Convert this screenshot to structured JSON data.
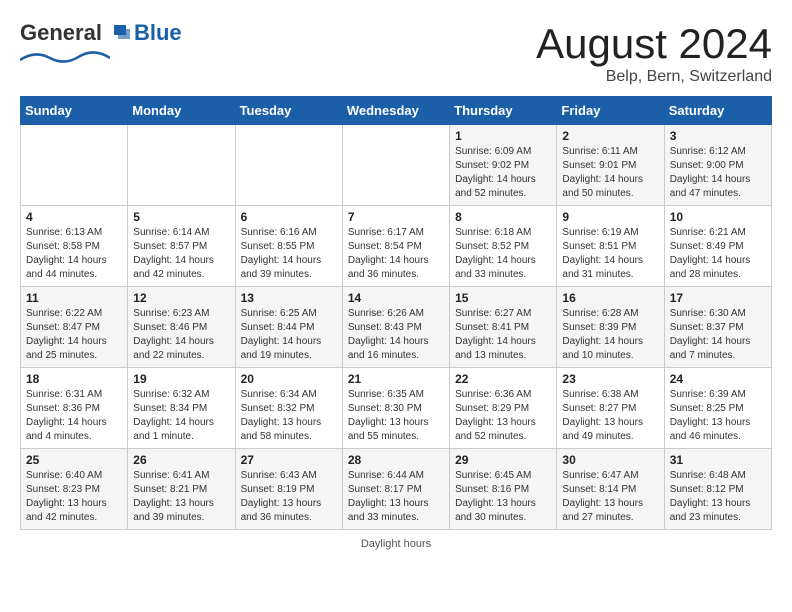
{
  "header": {
    "logo_general": "General",
    "logo_blue": "Blue",
    "month": "August 2024",
    "location": "Belp, Bern, Switzerland"
  },
  "days_of_week": [
    "Sunday",
    "Monday",
    "Tuesday",
    "Wednesday",
    "Thursday",
    "Friday",
    "Saturday"
  ],
  "weeks": [
    [
      {
        "day": "",
        "info": ""
      },
      {
        "day": "",
        "info": ""
      },
      {
        "day": "",
        "info": ""
      },
      {
        "day": "",
        "info": ""
      },
      {
        "day": "1",
        "info": "Sunrise: 6:09 AM\nSunset: 9:02 PM\nDaylight: 14 hours\nand 52 minutes."
      },
      {
        "day": "2",
        "info": "Sunrise: 6:11 AM\nSunset: 9:01 PM\nDaylight: 14 hours\nand 50 minutes."
      },
      {
        "day": "3",
        "info": "Sunrise: 6:12 AM\nSunset: 9:00 PM\nDaylight: 14 hours\nand 47 minutes."
      }
    ],
    [
      {
        "day": "4",
        "info": "Sunrise: 6:13 AM\nSunset: 8:58 PM\nDaylight: 14 hours\nand 44 minutes."
      },
      {
        "day": "5",
        "info": "Sunrise: 6:14 AM\nSunset: 8:57 PM\nDaylight: 14 hours\nand 42 minutes."
      },
      {
        "day": "6",
        "info": "Sunrise: 6:16 AM\nSunset: 8:55 PM\nDaylight: 14 hours\nand 39 minutes."
      },
      {
        "day": "7",
        "info": "Sunrise: 6:17 AM\nSunset: 8:54 PM\nDaylight: 14 hours\nand 36 minutes."
      },
      {
        "day": "8",
        "info": "Sunrise: 6:18 AM\nSunset: 8:52 PM\nDaylight: 14 hours\nand 33 minutes."
      },
      {
        "day": "9",
        "info": "Sunrise: 6:19 AM\nSunset: 8:51 PM\nDaylight: 14 hours\nand 31 minutes."
      },
      {
        "day": "10",
        "info": "Sunrise: 6:21 AM\nSunset: 8:49 PM\nDaylight: 14 hours\nand 28 minutes."
      }
    ],
    [
      {
        "day": "11",
        "info": "Sunrise: 6:22 AM\nSunset: 8:47 PM\nDaylight: 14 hours\nand 25 minutes."
      },
      {
        "day": "12",
        "info": "Sunrise: 6:23 AM\nSunset: 8:46 PM\nDaylight: 14 hours\nand 22 minutes."
      },
      {
        "day": "13",
        "info": "Sunrise: 6:25 AM\nSunset: 8:44 PM\nDaylight: 14 hours\nand 19 minutes."
      },
      {
        "day": "14",
        "info": "Sunrise: 6:26 AM\nSunset: 8:43 PM\nDaylight: 14 hours\nand 16 minutes."
      },
      {
        "day": "15",
        "info": "Sunrise: 6:27 AM\nSunset: 8:41 PM\nDaylight: 14 hours\nand 13 minutes."
      },
      {
        "day": "16",
        "info": "Sunrise: 6:28 AM\nSunset: 8:39 PM\nDaylight: 14 hours\nand 10 minutes."
      },
      {
        "day": "17",
        "info": "Sunrise: 6:30 AM\nSunset: 8:37 PM\nDaylight: 14 hours\nand 7 minutes."
      }
    ],
    [
      {
        "day": "18",
        "info": "Sunrise: 6:31 AM\nSunset: 8:36 PM\nDaylight: 14 hours\nand 4 minutes."
      },
      {
        "day": "19",
        "info": "Sunrise: 6:32 AM\nSunset: 8:34 PM\nDaylight: 14 hours\nand 1 minute."
      },
      {
        "day": "20",
        "info": "Sunrise: 6:34 AM\nSunset: 8:32 PM\nDaylight: 13 hours\nand 58 minutes."
      },
      {
        "day": "21",
        "info": "Sunrise: 6:35 AM\nSunset: 8:30 PM\nDaylight: 13 hours\nand 55 minutes."
      },
      {
        "day": "22",
        "info": "Sunrise: 6:36 AM\nSunset: 8:29 PM\nDaylight: 13 hours\nand 52 minutes."
      },
      {
        "day": "23",
        "info": "Sunrise: 6:38 AM\nSunset: 8:27 PM\nDaylight: 13 hours\nand 49 minutes."
      },
      {
        "day": "24",
        "info": "Sunrise: 6:39 AM\nSunset: 8:25 PM\nDaylight: 13 hours\nand 46 minutes."
      }
    ],
    [
      {
        "day": "25",
        "info": "Sunrise: 6:40 AM\nSunset: 8:23 PM\nDaylight: 13 hours\nand 42 minutes."
      },
      {
        "day": "26",
        "info": "Sunrise: 6:41 AM\nSunset: 8:21 PM\nDaylight: 13 hours\nand 39 minutes."
      },
      {
        "day": "27",
        "info": "Sunrise: 6:43 AM\nSunset: 8:19 PM\nDaylight: 13 hours\nand 36 minutes."
      },
      {
        "day": "28",
        "info": "Sunrise: 6:44 AM\nSunset: 8:17 PM\nDaylight: 13 hours\nand 33 minutes."
      },
      {
        "day": "29",
        "info": "Sunrise: 6:45 AM\nSunset: 8:16 PM\nDaylight: 13 hours\nand 30 minutes."
      },
      {
        "day": "30",
        "info": "Sunrise: 6:47 AM\nSunset: 8:14 PM\nDaylight: 13 hours\nand 27 minutes."
      },
      {
        "day": "31",
        "info": "Sunrise: 6:48 AM\nSunset: 8:12 PM\nDaylight: 13 hours\nand 23 minutes."
      }
    ]
  ],
  "footer": {
    "note": "Daylight hours"
  }
}
